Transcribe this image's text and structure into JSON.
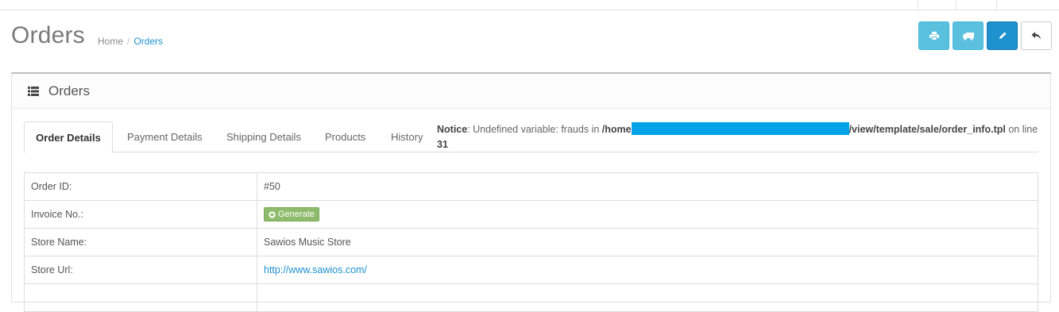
{
  "header": {
    "title": "Orders",
    "breadcrumb": [
      {
        "label": "Home"
      },
      {
        "label": "Orders"
      }
    ]
  },
  "toolbar": {
    "buttons": [
      {
        "icon": "print-icon",
        "style": "info"
      },
      {
        "icon": "truck-icon",
        "style": "info"
      },
      {
        "icon": "pencil-icon",
        "style": "primary"
      },
      {
        "icon": "reply-icon",
        "style": "default"
      }
    ]
  },
  "panel": {
    "title": "Orders",
    "icon": "list-icon"
  },
  "tabs": [
    {
      "label": "Order Details",
      "active": true
    },
    {
      "label": "Payment Details"
    },
    {
      "label": "Shipping Details"
    },
    {
      "label": "Products"
    },
    {
      "label": "History"
    }
  ],
  "notice": {
    "prefix": "Notice",
    "text": ": Undefined variable: frauds in ",
    "path_start": "/home",
    "path_end": "/view/template/sale/order_info.tpl",
    "line_text": " on line ",
    "line_no": "31"
  },
  "details": {
    "rows": [
      {
        "label": "Order ID:",
        "value": "#50"
      },
      {
        "label": "Invoice No.:",
        "button": "Generate"
      },
      {
        "label": "Store Name:",
        "value": "Sawios Music Store"
      },
      {
        "label": "Store Url:",
        "link": "http://www.sawios.com/"
      },
      {
        "label": "",
        "value": ""
      }
    ]
  },
  "colors": {
    "accent": "#1e91cf",
    "info": "#5bc0de",
    "success": "#8fbb6c",
    "redaction": "#00a2e8"
  }
}
